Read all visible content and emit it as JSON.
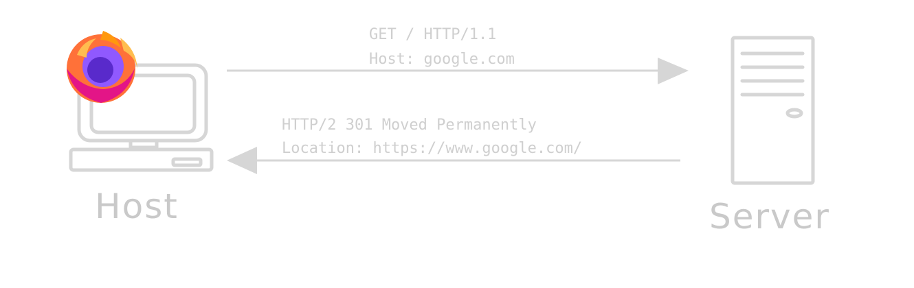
{
  "request": {
    "line1": "GET / HTTP/1.1",
    "line2": "Host: google.com"
  },
  "response": {
    "line1": "HTTP/2 301 Moved Permanently",
    "line2": "Location: https://www.google.com/"
  },
  "host_label": "Host",
  "server_label": "Server",
  "icons": {
    "host": "computer-icon",
    "browser": "firefox-logo",
    "server": "server-tower-icon"
  },
  "colors": {
    "stroke": "#d6d6d6",
    "text": "#cfcfcf",
    "background": "#ffffff"
  }
}
